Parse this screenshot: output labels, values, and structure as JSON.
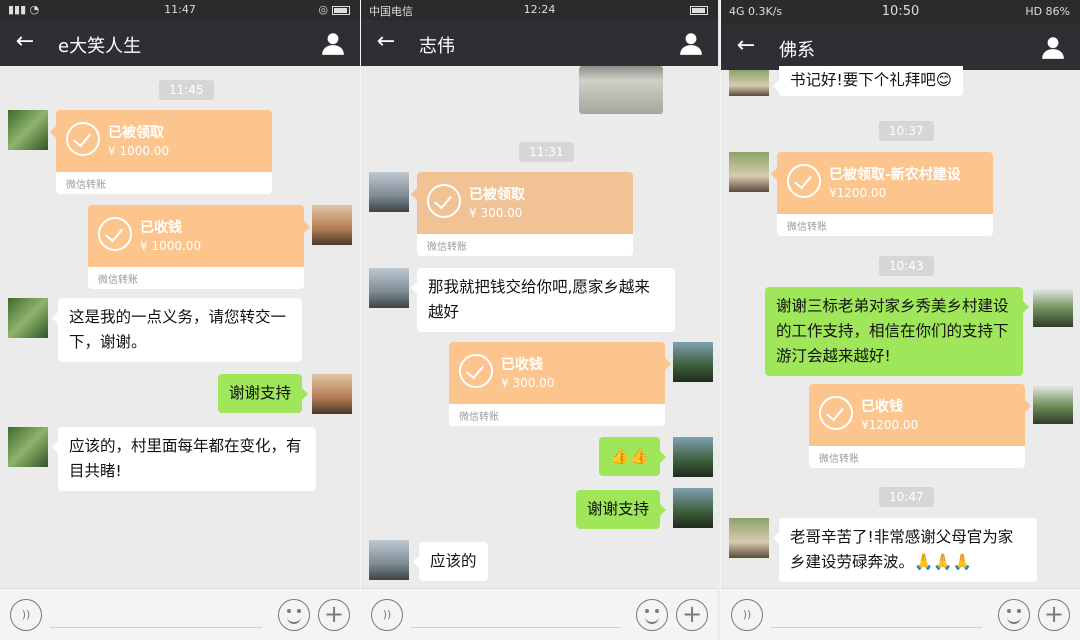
{
  "panels": [
    {
      "status": {
        "time": "11:47"
      },
      "nav": {
        "title": "e大笑人生"
      },
      "messages": {
        "t1": "11:45",
        "transfer1": {
          "title": "已被领取",
          "amount": "¥ 1000.00",
          "footer": "微信转账"
        },
        "transfer2": {
          "title": "已收钱",
          "amount": "¥ 1000.00",
          "footer": "微信转账"
        },
        "m1": "这是我的一点义务，请您转交一下，谢谢。",
        "m2": "谢谢支持",
        "m3": "应该的，村里面每年都在变化，有目共睹!"
      }
    },
    {
      "status": {
        "left": "中国电信",
        "time": "12:24"
      },
      "nav": {
        "title": "志伟"
      },
      "messages": {
        "t1": "11:31",
        "transfer1": {
          "title": "已被领取",
          "amount": "¥ 300.00",
          "footer": "微信转账"
        },
        "m1": "那我就把钱交给你吧,愿家乡越来越好",
        "transfer2": {
          "title": "已收钱",
          "amount": "¥ 300.00",
          "footer": "微信转账"
        },
        "m2": "👍👍",
        "m3": "谢谢支持",
        "m4": "应该的"
      }
    },
    {
      "status": {
        "left": "4G 0.3K/s",
        "time": "10:50",
        "right": "HD 86%"
      },
      "nav": {
        "title": "佛系"
      },
      "messages": {
        "m0": "书记好!要下个礼拜吧😊",
        "t1": "10:37",
        "transfer1": {
          "title": "已被领取-新农村建设",
          "amount": "¥1200.00",
          "footer": "微信转账"
        },
        "t2": "10:43",
        "m1": "谢谢三标老弟对家乡秀美乡村建设的工作支持，相信在你们的支持下游汀会越来越好!",
        "transfer2": {
          "title": "已收钱",
          "amount": "¥1200.00",
          "footer": "微信转账"
        },
        "t3": "10:47",
        "m2": "老哥辛苦了!非常感谢父母官为家乡建设劳碌奔波。🙏🙏🙏"
      }
    }
  ]
}
